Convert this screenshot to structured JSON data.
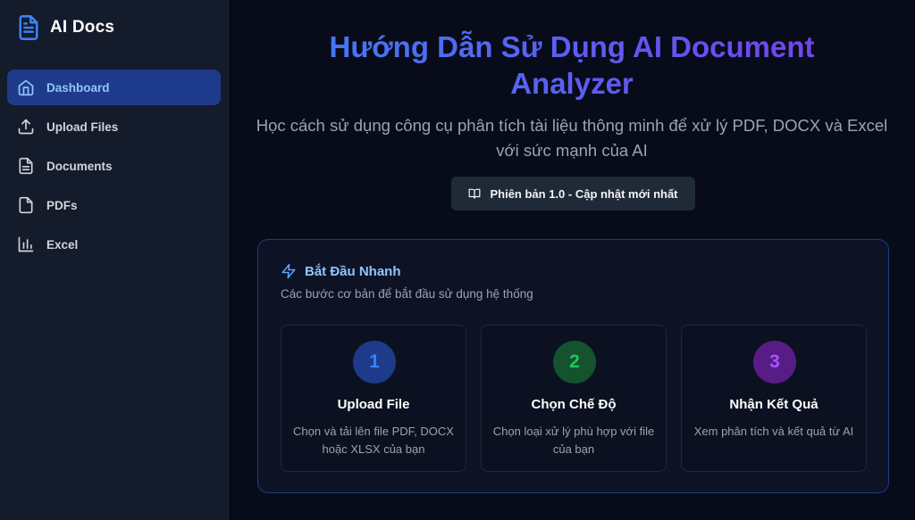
{
  "brand": {
    "title": "AI Docs",
    "icon": "document-icon",
    "color": "#3b82f6"
  },
  "sidebar": {
    "items": [
      {
        "label": "Dashboard",
        "icon": "home-icon",
        "active": true
      },
      {
        "label": "Upload Files",
        "icon": "upload-icon",
        "active": false
      },
      {
        "label": "Documents",
        "icon": "document-lines-icon",
        "active": false
      },
      {
        "label": "PDFs",
        "icon": "file-icon",
        "active": false
      },
      {
        "label": "Excel",
        "icon": "bar-chart-icon",
        "active": false
      }
    ]
  },
  "hero": {
    "title": "Hướng Dẫn Sử Dụng AI Document Analyzer",
    "subtitle": "Học cách sử dụng công cụ phân tích tài liệu thông minh để xử lý PDF, DOCX và Excel với sức mạnh của AI",
    "badge": "Phiên bản 1.0 - Cập nhật mới nhất",
    "badge_icon": "book-icon",
    "gradient": [
      "#3b82f6",
      "#7c3aed"
    ]
  },
  "quickstart": {
    "title": "Bắt Đầu Nhanh",
    "icon": "lightning-icon",
    "description": "Các bước cơ bản để bắt đầu sử dụng hệ thống",
    "steps": [
      {
        "number": "1",
        "title": "Upload File",
        "description": "Chọn và tải lên file PDF, DOCX hoặc XLSX của bạn",
        "bg": "#1e3a8a",
        "fg": "#3b82f6"
      },
      {
        "number": "2",
        "title": "Chọn Chế Độ",
        "description": "Chọn loại xử lý phù hợp với file của bạn",
        "bg": "#14532d",
        "fg": "#22c55e"
      },
      {
        "number": "3",
        "title": "Nhận Kết Quả",
        "description": "Xem phân tích và kết quả từ AI",
        "bg": "#581c87",
        "fg": "#a855f7"
      }
    ]
  }
}
